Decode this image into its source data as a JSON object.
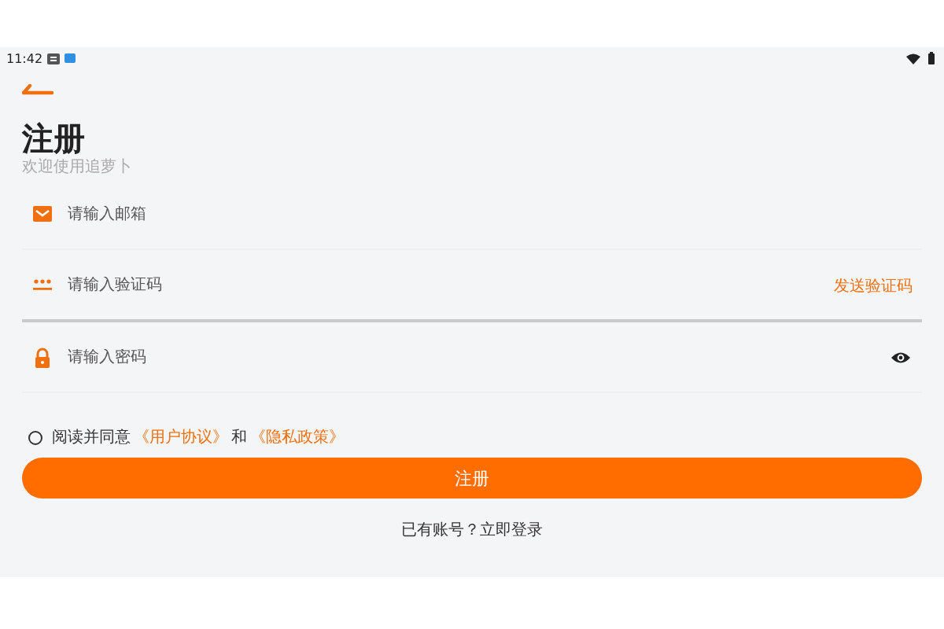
{
  "status_bar": {
    "time": "11:42"
  },
  "header": {
    "title": "注册",
    "subtitle": "欢迎使用追萝卜"
  },
  "fields": [
    {
      "kind": "email",
      "placeholder": "请输入邮箱",
      "focused": false
    },
    {
      "kind": "code",
      "placeholder": "请输入验证码",
      "focused": true,
      "action": "发送验证码"
    },
    {
      "kind": "password",
      "placeholder": "请输入密码",
      "focused": false
    }
  ],
  "agreement": {
    "agreed": false,
    "parts": [
      {
        "kind": "text",
        "text": "阅读并同意"
      },
      {
        "kind": "link",
        "text": "《用户协议》"
      },
      {
        "kind": "text",
        "text": "和"
      },
      {
        "kind": "link",
        "text": "《隐私政策》"
      }
    ]
  },
  "submit": "注册",
  "login_prompt": "已有账号？立即登录"
}
